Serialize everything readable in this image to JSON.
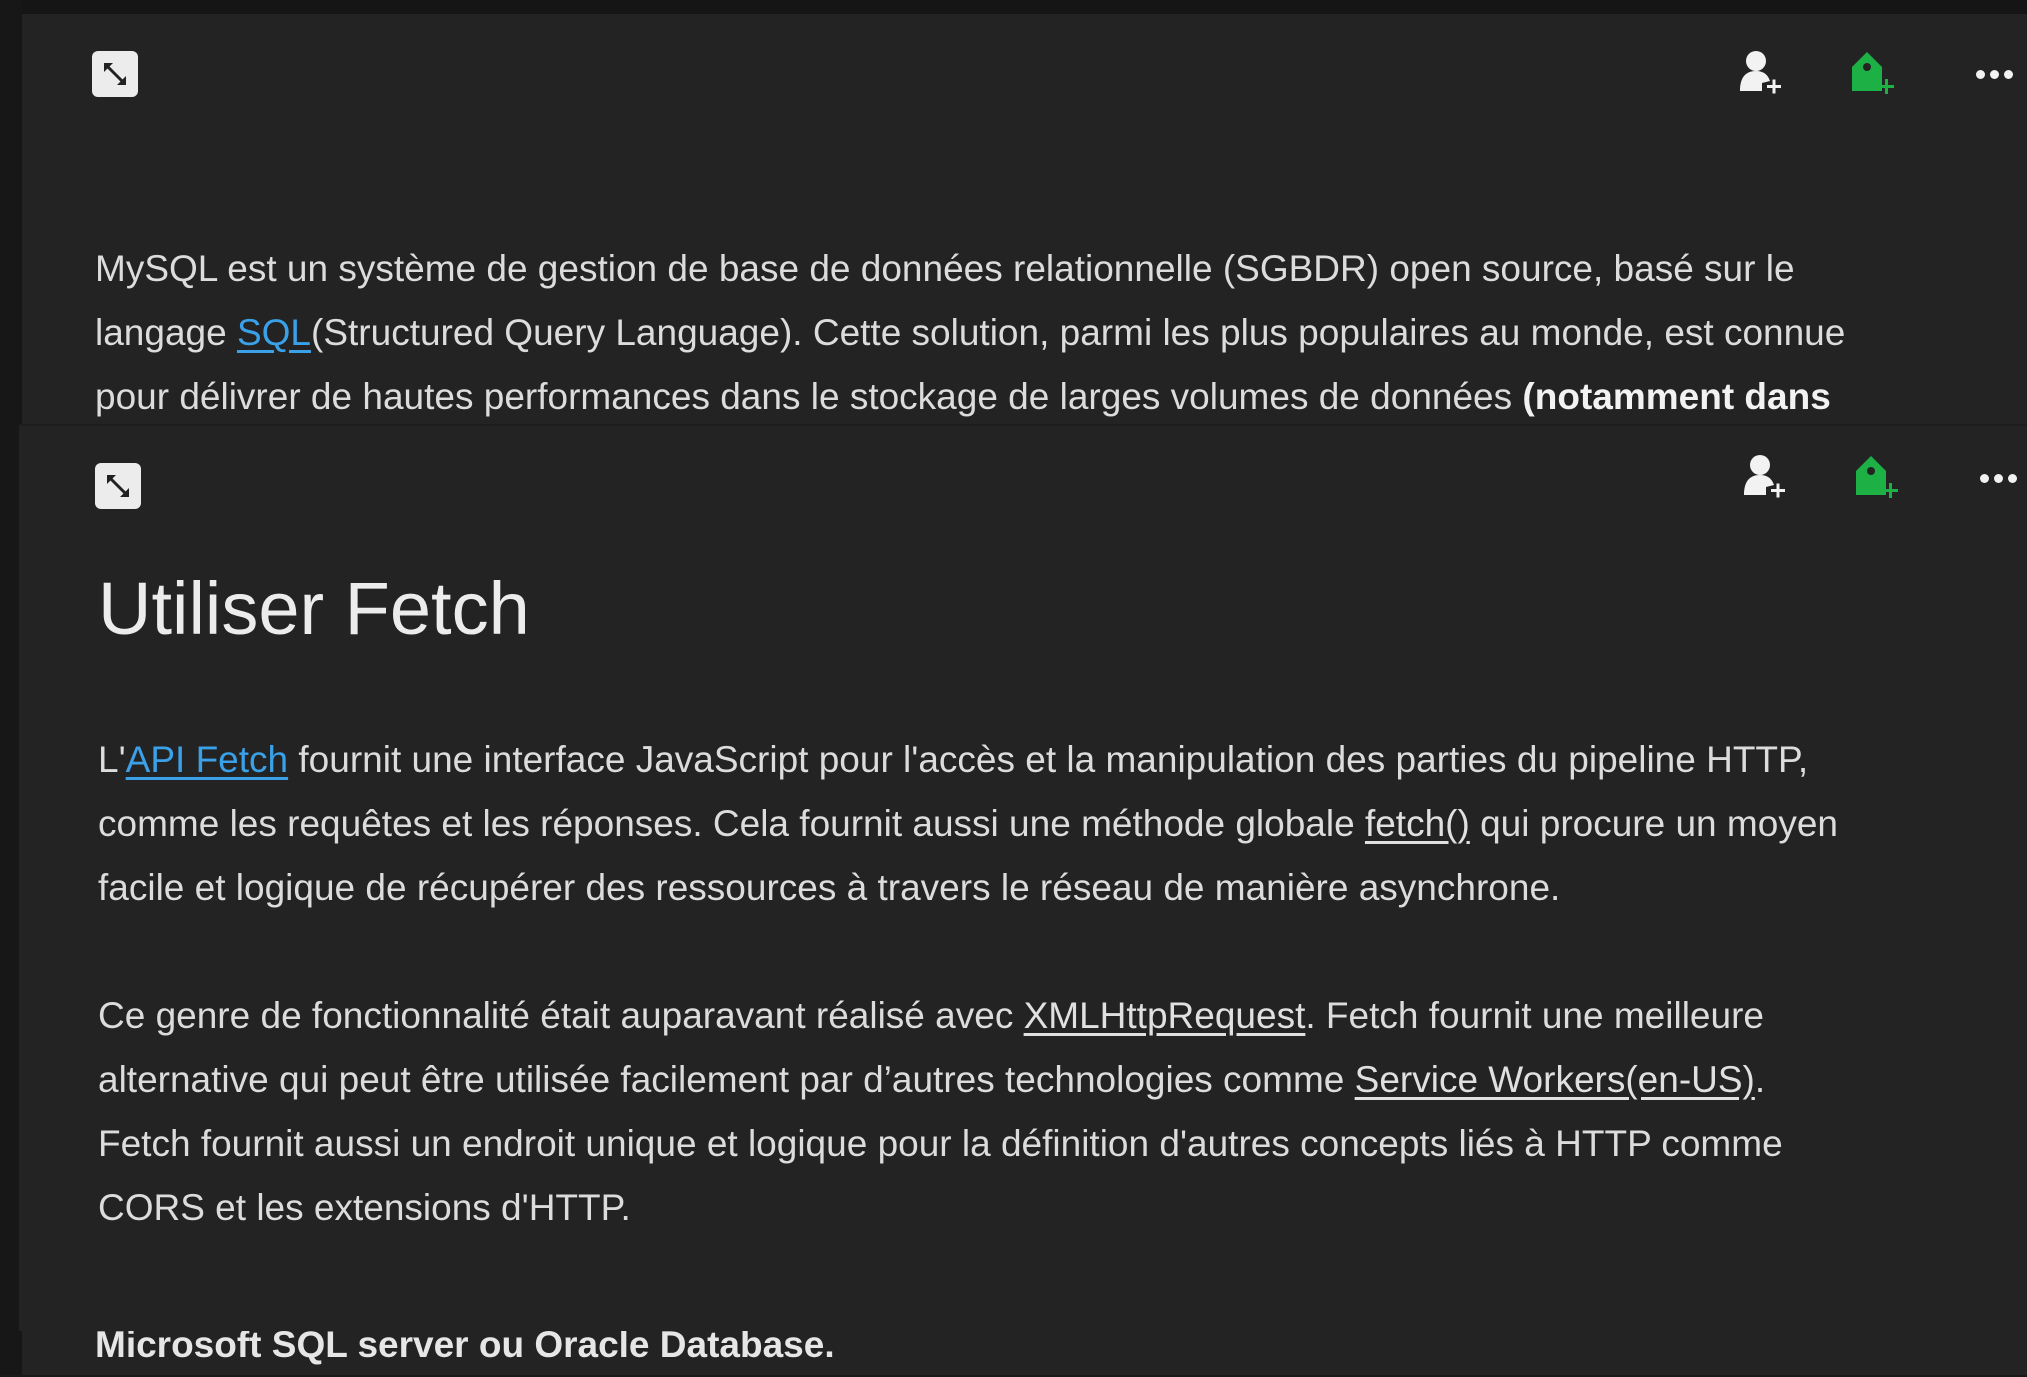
{
  "back_card": {
    "paragraph": {
      "line1": "MySQL est un système de gestion de base de données relationnelle (SGBDR) open source, basé sur le",
      "line2_prefix": "langage ",
      "line2_link": "SQL",
      "line2_suffix": "(Structured Query Language). Cette solution, parmi les plus populaires au monde, est connue",
      "line3_plain": "pour délivrer de hautes performances dans le stockage de larges volumes de données ",
      "line3_bold": "(notamment dans",
      "hidden_bold_line": "Microsoft SQL server ou Oracle Database."
    }
  },
  "front_card": {
    "title": "Utiliser Fetch",
    "p1": {
      "prefix": "L'",
      "link": "API Fetch",
      "line1_rest": " fournit une interface JavaScript pour l'accès et la manipulation des parties du pipeline HTTP,",
      "line2_start": "comme les requêtes et les réponses. Cela fournit aussi une méthode globale ",
      "line2_code": "fetch()",
      "line2_end": " qui procure un moyen",
      "line3": "facile et logique de récupérer des ressources à travers le réseau de manière asynchrone."
    },
    "p2": {
      "line1_start": "Ce genre de fonctionnalité était auparavant réalisé avec ",
      "line1_link": "XMLHttpRequest",
      "line1_end": ". Fetch fournit une meilleure",
      "line2_start": "alternative qui peut être utilisée facilement par d’autres technologies comme ",
      "line2_link": "Service Workers(en-US)",
      "line2_end": ".",
      "line3": "Fetch fournit aussi un endroit unique et logique pour la définition d'autres concepts liés à HTTP comme",
      "line4": "CORS et les extensions d'HTTP."
    }
  },
  "icons": {
    "expand": "expand-icon",
    "add_person": "add-person-icon",
    "add_tag": "add-tag-icon",
    "more": "more-icon"
  },
  "colors": {
    "background": "#232323",
    "link": "#3aa0e8",
    "tag_green": "#1db045"
  }
}
